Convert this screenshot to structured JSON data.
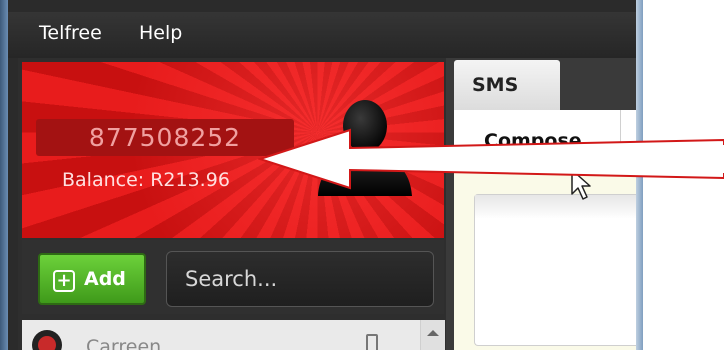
{
  "menu": {
    "items": [
      {
        "label": "Telfree"
      },
      {
        "label": "Help"
      }
    ]
  },
  "account": {
    "number": "877508252",
    "balance_label": "Balance: R213.96"
  },
  "toolbar": {
    "add_label": "Add",
    "search_placeholder": "Search..."
  },
  "contacts": {
    "items": [
      {
        "name": "Carreen"
      }
    ]
  },
  "tabs": {
    "sms_label": "SMS",
    "compose_label": "Compose"
  },
  "colors": {
    "banner_red": "#e81c1c",
    "add_green": "#53b22a",
    "annotation_arrow": "#e02020"
  },
  "icons": [
    "user-avatar-icon",
    "plus-icon",
    "contact-avatar-icon",
    "pin-icon",
    "scroll-up-icon",
    "mouse-cursor-icon",
    "annotation-arrow-icon"
  ]
}
